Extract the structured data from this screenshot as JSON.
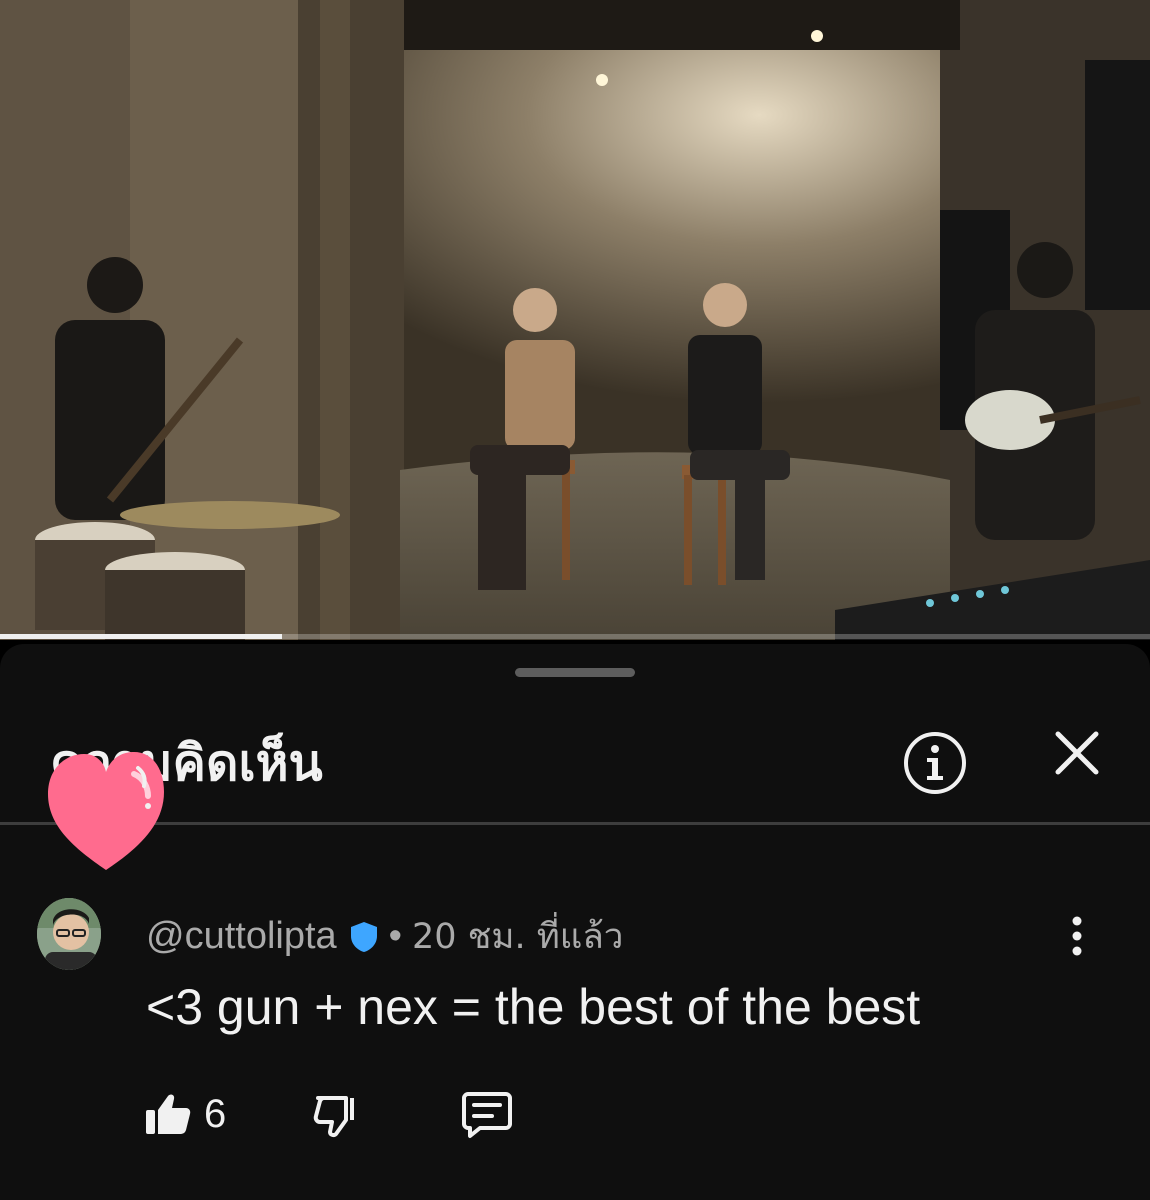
{
  "video": {
    "progress": 0.245
  },
  "comments_sheet": {
    "title": "ความคิดเห็น",
    "info_icon": "info-circle-icon",
    "close_icon": "close-icon"
  },
  "sticker": {
    "icon": "heart-sticker-icon",
    "color": "#ff6b8e"
  },
  "comment": {
    "author": "@cuttolipta",
    "verified_icon": "verified-shield-icon",
    "separator": "•",
    "time": "20 ชม. ที่แล้ว",
    "text": "<3 gun + nex = the best of the best",
    "like_count": "6",
    "more_icon": "more-vertical-icon",
    "like_icon": "thumbs-up-icon",
    "dislike_icon": "thumbs-down-icon",
    "reply_icon": "reply-comment-icon"
  },
  "colors": {
    "sheet_background": "#0f0f0f",
    "primary_text": "#f1f1f1",
    "secondary_text": "#aaaaaa",
    "verified_badge": "#3ea6ff"
  }
}
